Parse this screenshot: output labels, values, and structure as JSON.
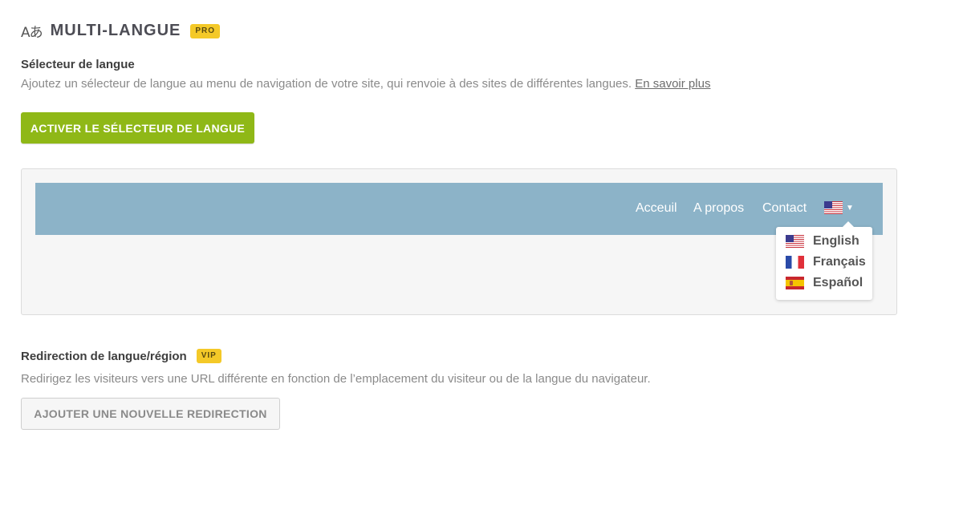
{
  "header": {
    "icon": "translate-icon",
    "icon_glyph": "Aあ",
    "title": "MULTI-LANGUE",
    "badge": "PRO"
  },
  "selector": {
    "title": "Sélecteur de langue",
    "description": "Ajoutez un sélecteur de langue au menu de navigation de votre site, qui renvoie à des sites de différentes langues.",
    "link": "En savoir plus",
    "button": "ACTIVER LE SÉLECTEUR DE LANGUE"
  },
  "preview": {
    "nav_items": [
      "Acceuil",
      "A propos",
      "Contact"
    ],
    "current_flag": "us-flag-icon",
    "caret": "▼",
    "languages": [
      {
        "label": "English",
        "flag": "us-flag-icon"
      },
      {
        "label": "Français",
        "flag": "fr-flag-icon"
      },
      {
        "label": "Español",
        "flag": "es-flag-icon"
      }
    ]
  },
  "redirect": {
    "title": "Redirection de langue/région",
    "badge": "VIP",
    "description": "Redirigez les visiteurs vers une URL différente en fonction de l’emplacement du visiteur ou de la langue du navigateur.",
    "button": "AJOUTER UNE NOUVELLE REDIRECTION"
  },
  "colors": {
    "primary_button": "#8fb817",
    "badge": "#f4c928",
    "navbar": "#8cb3c8"
  }
}
